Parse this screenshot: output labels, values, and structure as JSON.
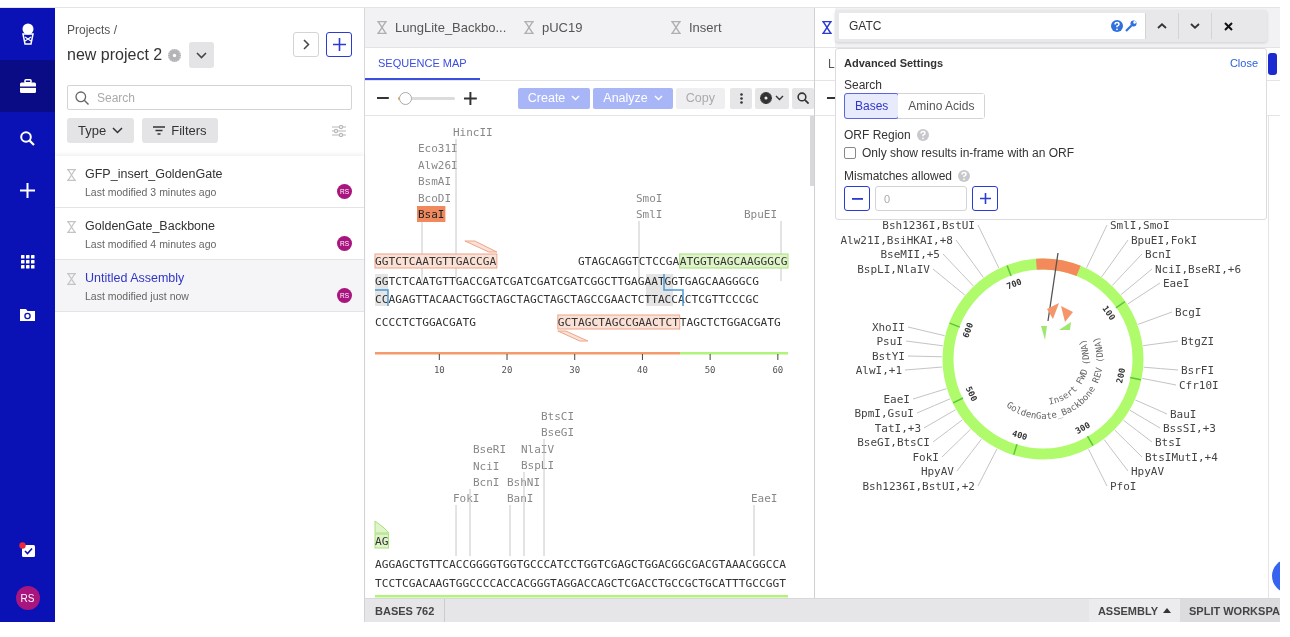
{
  "nav": {
    "items": [
      {
        "kind": "briefcase",
        "selected": true
      },
      {
        "kind": "search",
        "selected": false
      },
      {
        "kind": "add",
        "selected": false
      },
      {
        "kind": "apps",
        "selected": false
      },
      {
        "kind": "folder",
        "selected": false
      }
    ],
    "avatar": "RS"
  },
  "projects": {
    "breadcrumb": "Projects /",
    "title": "new project 2",
    "search": {
      "placeholder": "Search"
    },
    "filters": [
      "Type",
      "Filters"
    ],
    "items": [
      {
        "name": "GFP_insert_GoldenGate",
        "modified": "Last modified 3 minutes ago",
        "avatar": "RS",
        "selected": false
      },
      {
        "name": "GoldenGate_Backbone",
        "modified": "Last modified 4 minutes ago",
        "avatar": "RS",
        "selected": false
      },
      {
        "name": "Untitled Assembly",
        "modified": "Last modified just now",
        "avatar": "RS",
        "selected": true
      }
    ]
  },
  "editor": {
    "tabs": [
      {
        "label": "LungLite_Backbo...",
        "selected": false
      },
      {
        "label": "pUC19",
        "selected": false
      },
      {
        "label": "Insert",
        "selected": false
      }
    ],
    "view_tab": "SEQUENCE MAP",
    "zoom": {
      "level": 0.15
    },
    "actions": [
      {
        "label": "Create",
        "kind": "menu"
      },
      {
        "label": "Analyze",
        "kind": "menu"
      },
      {
        "label": "Copy",
        "kind": "plain"
      }
    ],
    "blocks": [
      {
        "enzymes": [
          {
            "labels": [
              {
                "name": "Eco31I",
                "highlighted": false
              },
              {
                "name": "Alw26I",
                "highlighted": false
              },
              {
                "name": "BsmAI",
                "highlighted": false
              },
              {
                "name": "BcoDI",
                "highlighted": false
              },
              {
                "name": "BsaI",
                "highlighted": true
              }
            ]
          },
          {
            "labels": [
              {
                "name": "HincII",
                "highlighted": false
              }
            ]
          },
          {
            "labels": [
              {
                "name": "SmoI",
                "highlighted": false
              },
              {
                "name": "SmlI",
                "highlighted": false
              }
            ]
          },
          {
            "labels": [
              {
                "name": "BpuEI",
                "highlighted": false
              }
            ]
          }
        ],
        "lines": [
          {
            "segments": [
              {
                "text": "GGTCTCAATGTTGACCGA",
                "kind": "forward"
              },
              {
                "text": "GTAGCAGGTCTCCGA",
                "kind": "plain"
              },
              {
                "text": "ATGGTGAGCAAGGGCG",
                "kind": "feature"
              }
            ]
          },
          {
            "segments": [
              {
                "text": "GGTCTCAATGTTGACCGATCGATCGATCGATCGGCTTGAGAATGGTGAGCAAGGGCG",
                "kind": "plain"
              }
            ]
          },
          {
            "segments": [
              {
                "text": "CCAGAGTTACAACTGGCTAGCTAGCTAGCTAGCCGAACTCTTACCACTCGTTCCCGC",
                "kind": "plain"
              }
            ]
          },
          {
            "segments": [
              {
                "text": "CCCCTCTGGACGATG",
                "kind": "plain"
              },
              {
                "text": "GCTAGCTAGCCGAACTCT",
                "kind": "reverse"
              },
              {
                "text": "TAGCTCTGGACGATG",
                "kind": "plain"
              }
            ]
          }
        ]
      },
      {
        "enzymes": [
          {
            "labels": [
              {
                "name": "FokI",
                "highlighted": false
              }
            ]
          },
          {
            "labels": [
              {
                "name": "BseRI",
                "highlighted": false
              },
              {
                "name": "NciI",
                "highlighted": false
              },
              {
                "name": "BcnI",
                "highlighted": false
              }
            ]
          },
          {
            "labels": [
              {
                "name": "BshNI",
                "highlighted": false
              },
              {
                "name": "BanI",
                "highlighted": false
              }
            ]
          },
          {
            "labels": [
              {
                "name": "NlaIV",
                "highlighted": false
              },
              {
                "name": "BspLI",
                "highlighted": false
              }
            ]
          },
          {
            "labels": [
              {
                "name": "BtsCI",
                "highlighted": false
              },
              {
                "name": "BseGI",
                "highlighted": false
              }
            ]
          },
          {
            "labels": [
              {
                "name": "EaeI",
                "highlighted": false
              }
            ]
          }
        ],
        "lines": [
          {
            "segments": [
              {
                "text": "AG",
                "kind": "arrowfeature"
              }
            ]
          },
          {
            "segments": [
              {
                "text": "AGGAGCTGTTCACCGGGGTGGTGCCCATCCTGGTCGAGCTGGACGGCGACGTAAACGGCCA",
                "kind": "plain"
              }
            ]
          },
          {
            "segments": [
              {
                "text": "TCCTCGACAAGTGGCCCCACCACGGGTAGGACCAGCTCGACCTGCCGCTGCATTTGCCGGT",
                "kind": "plain"
              }
            ]
          }
        ]
      }
    ],
    "ruler": {
      "ticks": [
        "10",
        "20",
        "30",
        "40",
        "50",
        "60"
      ]
    }
  },
  "workspace": {
    "view_tab": "L",
    "map": {
      "left_labels": [
        "Bsh1236I,BstUI",
        "Alw21I,BsiHKAI,+8",
        "BseMII,+5",
        "BspLI,NlaIV",
        "XhoII",
        "PsuI",
        "BstYI",
        "AlwI,+1",
        "EaeI",
        "BpmI,GsuI",
        "TatI,+3",
        "BseGI,BtsCI",
        "FokI",
        "HpyAV",
        "Bsh1236I,BstUI,+2"
      ],
      "right_labels": [
        "SmlI,SmoI",
        "BpuEI,FokI",
        "BcnI",
        "NciI,BseRI,+6",
        "EaeI",
        "BcgI",
        "BtgZI",
        "BsrFI",
        "Cfr10I",
        "BauI",
        "BssSI,+3",
        "BtsI",
        "BtsIMutI,+4",
        "HpyAV",
        "PfoI"
      ],
      "ticks": [
        "100",
        "200",
        "300",
        "400",
        "500",
        "600",
        "700"
      ],
      "arcs": [
        {
          "label": "Insert FWD (DNA)"
        },
        {
          "label": "GoldenGate_Backbone REV (DNA)"
        }
      ]
    }
  },
  "search_popup": {
    "query": "GATC",
    "title": "Advanced Settings",
    "close": "Close",
    "search_label": "Search",
    "modes": [
      {
        "label": "Bases",
        "selected": true
      },
      {
        "label": "Amino Acids",
        "selected": false
      }
    ],
    "orf": {
      "label": "ORF Region",
      "option": "Only show results in-frame with an ORF",
      "checked": false
    },
    "mismatches": {
      "label": "Mismatches allowed",
      "placeholder": "0"
    }
  },
  "status_bar": {
    "bases": "BASES 762",
    "buttons": [
      {
        "label": "ASSEMBLY",
        "kind": "menu"
      },
      {
        "label": "SPLIT WORKSPA",
        "kind": "plain"
      }
    ]
  }
}
